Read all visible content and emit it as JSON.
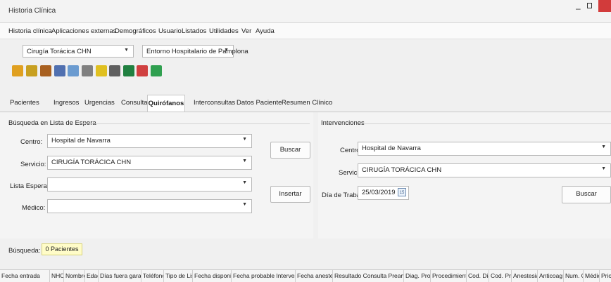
{
  "window": {
    "title": "Historia Clínica"
  },
  "menu": [
    "Historia clínica",
    "Aplicaciones externas",
    "Demográficos",
    "Usuario",
    "Listados",
    "Utilidades",
    "Ver",
    "Ayuda"
  ],
  "selectors": {
    "service": "Cirugía Torácica CHN",
    "environment": "Entorno Hospitalario de Pamplona"
  },
  "toolbar": {
    "icons": [
      "exit-icon",
      "people-icon",
      "scissors-icon",
      "pen-icon",
      "document-icon",
      "funnel-icon",
      "notebook-icon",
      "printer-icon",
      "excel-icon",
      "transfer-icon",
      "save-icon"
    ],
    "colors": [
      "#e0a020",
      "#c8a020",
      "#a86020",
      "#5070b0",
      "#6b9bd0",
      "#808080",
      "#e0c020",
      "#606060",
      "#208040",
      "#d04040",
      "#30a050"
    ]
  },
  "tabs": [
    "Pacientes",
    "Ingresos",
    "Urgencias",
    "Consultas",
    "Quirófanos",
    "Interconsultas",
    "Datos Paciente",
    "Resumen Clínico"
  ],
  "active_tab": "Quirófanos",
  "waitlist": {
    "heading": "Búsqueda en Lista de Espera",
    "centro_label": "Centro:",
    "centro_value": "Hospital de Navarra",
    "servicio_label": "Servicio:",
    "servicio_value": "CIRUGÍA TORÁCICA CHN",
    "lista_label": "Lista Espera:",
    "lista_value": "",
    "medico_label": "Médico:",
    "medico_value": "",
    "buscar": "Buscar",
    "insertar": "Insertar"
  },
  "interventions": {
    "heading": "Intervenciones",
    "centro_label": "Centro:",
    "centro_value": "Hospital de Navarra",
    "servicio_label": "Servicio:",
    "servicio_value": "CIRUGÍA TORÁCICA CHN",
    "dia_label": "Día de Trabajo:",
    "dia_value": "25/03/2019",
    "cal_icon": "15",
    "buscar": "Buscar"
  },
  "search": {
    "label": "Búsqueda:",
    "count": "0 Pacientes"
  },
  "columns": [
    "Fecha entrada",
    "NHC",
    "Nombre",
    "Edad",
    "Días fuera garantía",
    "Teléfono",
    "Tipo de Lista",
    "Fecha disponible",
    "Fecha probable Intervención",
    "Fecha anestesia",
    "Resultado Consulta Preanestesia",
    "Diag. Proc.",
    "Procedimiento",
    "Cod. Dia",
    "Cod. Pro",
    "Anestesia",
    "Anticoag",
    "Num. Col.",
    "Médico",
    "Priorid"
  ]
}
